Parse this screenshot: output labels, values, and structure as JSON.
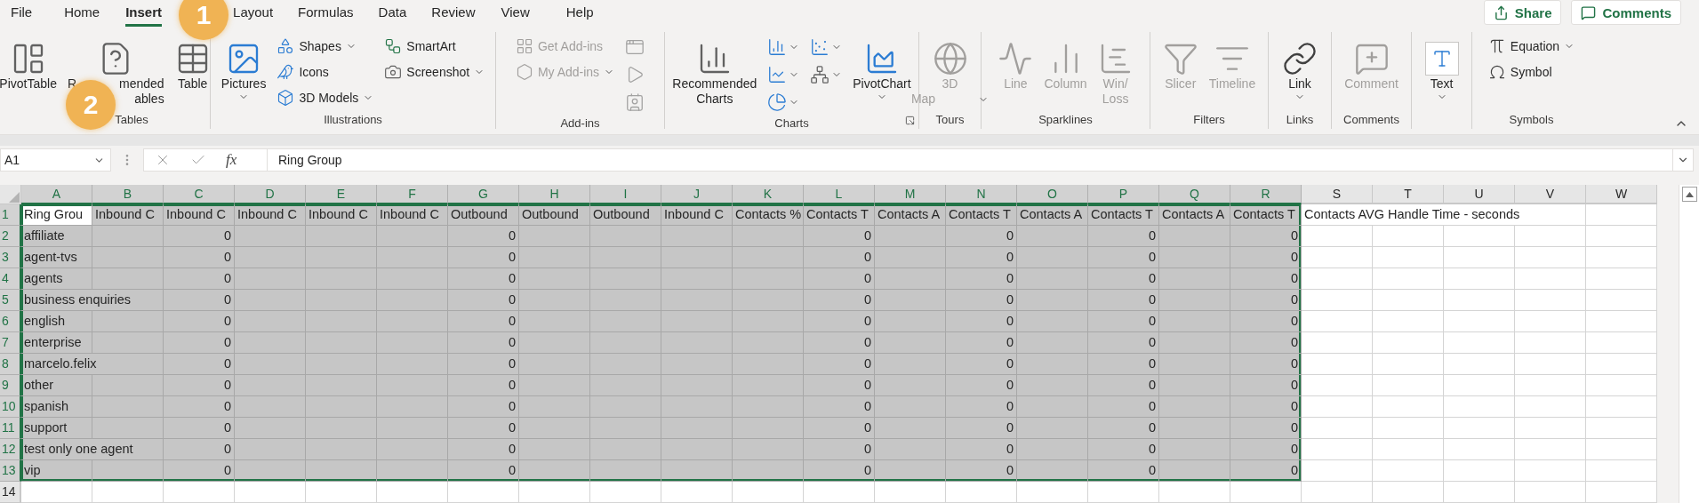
{
  "menu_tabs": [
    {
      "label": "File",
      "selected": false
    },
    {
      "label": "Home",
      "selected": false
    },
    {
      "label": "Insert",
      "selected": true
    },
    {
      "label": "Layout",
      "selected": false
    },
    {
      "label": "Formulas",
      "selected": false
    },
    {
      "label": "Data",
      "selected": false
    },
    {
      "label": "Review",
      "selected": false
    },
    {
      "label": "View",
      "selected": false
    },
    {
      "label": "Help",
      "selected": false
    }
  ],
  "header_buttons": [
    {
      "label": "Share"
    },
    {
      "label": "Comments"
    }
  ],
  "ribbon_groups": [
    {
      "label": "Tables",
      "items": [
        {
          "kind": "large",
          "lines": [
            [
              "PivotTable"
            ]
          ],
          "dropdown": false,
          "disabled": false
        },
        {
          "kind": "large",
          "lines": [
            [
              "R",
              "mended"
            ],
            [
              "ables"
            ]
          ],
          "dropdown": false,
          "disabled": false
        },
        {
          "kind": "large",
          "lines": [
            [
              "Table"
            ]
          ],
          "dropdown": false,
          "disabled": false
        }
      ]
    },
    {
      "label": "Illustrations",
      "items": [
        {
          "kind": "large",
          "lines": [
            [
              "Pictures"
            ]
          ],
          "dropdown": true,
          "disabled": false
        },
        {
          "kind": "stack",
          "items": [
            {
              "kind": "small",
              "label": "Shapes",
              "dropdown": true,
              "disabled": false
            },
            {
              "kind": "small",
              "label": "Icons",
              "dropdown": false,
              "disabled": false
            },
            {
              "kind": "small",
              "label": "3D Models",
              "dropdown": true,
              "disabled": false
            }
          ]
        },
        {
          "kind": "stack",
          "items": [
            {
              "kind": "small",
              "label": "SmartArt",
              "dropdown": false,
              "disabled": false
            },
            {
              "kind": "small",
              "label": "Screenshot",
              "dropdown": true,
              "disabled": false
            }
          ]
        }
      ]
    },
    {
      "label": "Add-ins",
      "items": [
        {
          "kind": "stack",
          "items": [
            {
              "kind": "small",
              "label": "Get Add-ins",
              "dropdown": false,
              "disabled": true
            },
            {
              "kind": "small",
              "label": "My Add-ins",
              "dropdown": true,
              "disabled": true
            }
          ]
        },
        {
          "kind": "stack",
          "items": [
            {
              "kind": "icon",
              "dropdown": false,
              "disabled": true
            },
            {
              "kind": "icon",
              "dropdown": false,
              "disabled": true
            },
            {
              "kind": "icon",
              "dropdown": false,
              "disabled": true
            }
          ]
        }
      ]
    },
    {
      "label": "Charts",
      "launcher": true,
      "items": [
        {
          "kind": "large",
          "lines": [
            [
              "Recommended"
            ],
            [
              "Charts"
            ]
          ],
          "dropdown": false,
          "disabled": false
        },
        {
          "kind": "stack",
          "items": [
            {
              "kind": "icon",
              "dropdown": true,
              "disabled": false
            },
            {
              "kind": "icon",
              "dropdown": true,
              "disabled": false
            },
            {
              "kind": "icon",
              "dropdown": true,
              "disabled": false
            }
          ]
        },
        {
          "kind": "stack",
          "items": [
            {
              "kind": "icon",
              "dropdown": true,
              "disabled": false
            },
            {
              "kind": "icon",
              "dropdown": true,
              "disabled": false
            }
          ]
        },
        {
          "kind": "large",
          "lines": [
            [
              "PivotChart"
            ]
          ],
          "dropdown": true,
          "disabled": false
        }
      ]
    },
    {
      "label": "Tours",
      "items": [
        {
          "kind": "large",
          "lines": [
            [
              "3D"
            ],
            [
              "Map"
            ]
          ],
          "dropdown": true,
          "disabled": true
        }
      ]
    },
    {
      "label": "Sparklines",
      "items": [
        {
          "kind": "large",
          "lines": [
            [
              "Line"
            ]
          ],
          "dropdown": false,
          "disabled": true
        },
        {
          "kind": "large",
          "lines": [
            [
              "Column"
            ]
          ],
          "dropdown": false,
          "disabled": true
        },
        {
          "kind": "large",
          "lines": [
            [
              "Win/"
            ],
            [
              "Loss"
            ]
          ],
          "dropdown": false,
          "disabled": true
        }
      ]
    },
    {
      "label": "Filters",
      "items": [
        {
          "kind": "large",
          "lines": [
            [
              "Slicer"
            ]
          ],
          "dropdown": false,
          "disabled": true
        },
        {
          "kind": "large",
          "lines": [
            [
              "Timeline"
            ]
          ],
          "dropdown": false,
          "disabled": true
        }
      ]
    },
    {
      "label": "Links",
      "items": [
        {
          "kind": "large",
          "lines": [
            [
              "Link"
            ]
          ],
          "dropdown": true,
          "disabled": false
        }
      ]
    },
    {
      "label": "Comments",
      "items": [
        {
          "kind": "large",
          "lines": [
            [
              "Comment"
            ]
          ],
          "dropdown": false,
          "disabled": true
        }
      ]
    },
    {
      "items": [
        {
          "kind": "large",
          "lines": [
            [
              "Text"
            ]
          ],
          "dropdown": true,
          "disabled": false
        }
      ]
    },
    {
      "label": "Symbols",
      "items": [
        {
          "kind": "stack",
          "items": [
            {
              "kind": "small",
              "label": "Equation",
              "dropdown": true,
              "disabled": false
            },
            {
              "kind": "small",
              "label": "Symbol",
              "dropdown": false,
              "disabled": false
            }
          ]
        }
      ]
    }
  ],
  "annotations": [
    {
      "label": "1"
    },
    {
      "label": "2"
    }
  ],
  "formula_bar": {
    "name_box": "A1",
    "function_label": "fx",
    "value": "Ring Group"
  },
  "sheet": {
    "columns": [
      {
        "header": "A",
        "selected": true
      },
      {
        "header": "B",
        "selected": true
      },
      {
        "header": "C",
        "selected": true
      },
      {
        "header": "D",
        "selected": true
      },
      {
        "header": "E",
        "selected": true
      },
      {
        "header": "F",
        "selected": true
      },
      {
        "header": "G",
        "selected": true
      },
      {
        "header": "H",
        "selected": true
      },
      {
        "header": "I",
        "selected": true
      },
      {
        "header": "J",
        "selected": true
      },
      {
        "header": "K",
        "selected": true
      },
      {
        "header": "L",
        "selected": true
      },
      {
        "header": "M",
        "selected": true
      },
      {
        "header": "N",
        "selected": true
      },
      {
        "header": "O",
        "selected": true
      },
      {
        "header": "P",
        "selected": true
      },
      {
        "header": "Q",
        "selected": true
      },
      {
        "header": "R",
        "selected": true
      },
      {
        "header": "S",
        "selected": false
      },
      {
        "header": "T",
        "selected": false
      },
      {
        "header": "U",
        "selected": false
      },
      {
        "header": "V",
        "selected": false
      },
      {
        "header": "W",
        "selected": false
      }
    ],
    "rows": [
      {
        "header": "1",
        "selected": true,
        "cells": [
          {
            "kind": "text",
            "text": "Ring Grou"
          },
          {
            "kind": "text",
            "text": "Inbound C"
          },
          {
            "kind": "text",
            "text": "Inbound C"
          },
          {
            "kind": "text",
            "text": "Inbound C"
          },
          {
            "kind": "text",
            "text": "Inbound C"
          },
          {
            "kind": "text",
            "text": "Inbound C"
          },
          {
            "kind": "text",
            "text": "Outbound"
          },
          {
            "kind": "text",
            "text": "Outbound"
          },
          {
            "kind": "text",
            "text": "Outbound"
          },
          {
            "kind": "text",
            "text": "Inbound C"
          },
          {
            "kind": "text",
            "text": "Contacts %"
          },
          {
            "kind": "text",
            "text": "Contacts T"
          },
          {
            "kind": "text",
            "text": "Contacts A"
          },
          {
            "kind": "text",
            "text": "Contacts T"
          },
          {
            "kind": "text",
            "text": "Contacts A"
          },
          {
            "kind": "text",
            "text": "Contacts T"
          },
          {
            "kind": "text",
            "text": "Contacts A"
          },
          {
            "kind": "text",
            "text": "Contacts T"
          },
          {
            "kind": "text",
            "text": "Contacts AVG Handle Time - seconds"
          },
          null,
          null,
          null,
          null
        ]
      },
      {
        "header": "2",
        "selected": true,
        "cells": [
          {
            "kind": "text",
            "text": "affiliate"
          },
          null,
          {
            "kind": "number",
            "text": "0"
          },
          null,
          null,
          null,
          {
            "kind": "number",
            "text": "0"
          },
          null,
          null,
          null,
          null,
          {
            "kind": "number",
            "text": "0"
          },
          null,
          {
            "kind": "number",
            "text": "0"
          },
          null,
          {
            "kind": "number",
            "text": "0"
          },
          null,
          {
            "kind": "number",
            "text": "0"
          },
          null,
          null,
          null,
          null,
          null
        ]
      },
      {
        "header": "3",
        "selected": true,
        "cells": [
          {
            "kind": "text",
            "text": "agent-tvs"
          },
          null,
          {
            "kind": "number",
            "text": "0"
          },
          null,
          null,
          null,
          {
            "kind": "number",
            "text": "0"
          },
          null,
          null,
          null,
          null,
          {
            "kind": "number",
            "text": "0"
          },
          null,
          {
            "kind": "number",
            "text": "0"
          },
          null,
          {
            "kind": "number",
            "text": "0"
          },
          null,
          {
            "kind": "number",
            "text": "0"
          },
          null,
          null,
          null,
          null,
          null
        ]
      },
      {
        "header": "4",
        "selected": true,
        "cells": [
          {
            "kind": "text",
            "text": "agents"
          },
          null,
          {
            "kind": "number",
            "text": "0"
          },
          null,
          null,
          null,
          {
            "kind": "number",
            "text": "0"
          },
          null,
          null,
          null,
          null,
          {
            "kind": "number",
            "text": "0"
          },
          null,
          {
            "kind": "number",
            "text": "0"
          },
          null,
          {
            "kind": "number",
            "text": "0"
          },
          null,
          {
            "kind": "number",
            "text": "0"
          },
          null,
          null,
          null,
          null,
          null
        ]
      },
      {
        "header": "5",
        "selected": true,
        "cells": [
          {
            "kind": "text",
            "text": "business enquiries"
          },
          null,
          {
            "kind": "number",
            "text": "0"
          },
          null,
          null,
          null,
          {
            "kind": "number",
            "text": "0"
          },
          null,
          null,
          null,
          null,
          {
            "kind": "number",
            "text": "0"
          },
          null,
          {
            "kind": "number",
            "text": "0"
          },
          null,
          {
            "kind": "number",
            "text": "0"
          },
          null,
          {
            "kind": "number",
            "text": "0"
          },
          null,
          null,
          null,
          null,
          null
        ]
      },
      {
        "header": "6",
        "selected": true,
        "cells": [
          {
            "kind": "text",
            "text": "english"
          },
          null,
          {
            "kind": "number",
            "text": "0"
          },
          null,
          null,
          null,
          {
            "kind": "number",
            "text": "0"
          },
          null,
          null,
          null,
          null,
          {
            "kind": "number",
            "text": "0"
          },
          null,
          {
            "kind": "number",
            "text": "0"
          },
          null,
          {
            "kind": "number",
            "text": "0"
          },
          null,
          {
            "kind": "number",
            "text": "0"
          },
          null,
          null,
          null,
          null,
          null
        ]
      },
      {
        "header": "7",
        "selected": true,
        "cells": [
          {
            "kind": "text",
            "text": "enterprise"
          },
          null,
          {
            "kind": "number",
            "text": "0"
          },
          null,
          null,
          null,
          {
            "kind": "number",
            "text": "0"
          },
          null,
          null,
          null,
          null,
          {
            "kind": "number",
            "text": "0"
          },
          null,
          {
            "kind": "number",
            "text": "0"
          },
          null,
          {
            "kind": "number",
            "text": "0"
          },
          null,
          {
            "kind": "number",
            "text": "0"
          },
          null,
          null,
          null,
          null,
          null
        ]
      },
      {
        "header": "8",
        "selected": true,
        "cells": [
          {
            "kind": "text",
            "text": "marcelo.felix"
          },
          null,
          {
            "kind": "number",
            "text": "0"
          },
          null,
          null,
          null,
          {
            "kind": "number",
            "text": "0"
          },
          null,
          null,
          null,
          null,
          {
            "kind": "number",
            "text": "0"
          },
          null,
          {
            "kind": "number",
            "text": "0"
          },
          null,
          {
            "kind": "number",
            "text": "0"
          },
          null,
          {
            "kind": "number",
            "text": "0"
          },
          null,
          null,
          null,
          null,
          null
        ]
      },
      {
        "header": "9",
        "selected": true,
        "cells": [
          {
            "kind": "text",
            "text": "other"
          },
          null,
          {
            "kind": "number",
            "text": "0"
          },
          null,
          null,
          null,
          {
            "kind": "number",
            "text": "0"
          },
          null,
          null,
          null,
          null,
          {
            "kind": "number",
            "text": "0"
          },
          null,
          {
            "kind": "number",
            "text": "0"
          },
          null,
          {
            "kind": "number",
            "text": "0"
          },
          null,
          {
            "kind": "number",
            "text": "0"
          },
          null,
          null,
          null,
          null,
          null
        ]
      },
      {
        "header": "10",
        "selected": true,
        "cells": [
          {
            "kind": "text",
            "text": "spanish"
          },
          null,
          {
            "kind": "number",
            "text": "0"
          },
          null,
          null,
          null,
          {
            "kind": "number",
            "text": "0"
          },
          null,
          null,
          null,
          null,
          {
            "kind": "number",
            "text": "0"
          },
          null,
          {
            "kind": "number",
            "text": "0"
          },
          null,
          {
            "kind": "number",
            "text": "0"
          },
          null,
          {
            "kind": "number",
            "text": "0"
          },
          null,
          null,
          null,
          null,
          null
        ]
      },
      {
        "header": "11",
        "selected": true,
        "cells": [
          {
            "kind": "text",
            "text": "support"
          },
          null,
          {
            "kind": "number",
            "text": "0"
          },
          null,
          null,
          null,
          {
            "kind": "number",
            "text": "0"
          },
          null,
          null,
          null,
          null,
          {
            "kind": "number",
            "text": "0"
          },
          null,
          {
            "kind": "number",
            "text": "0"
          },
          null,
          {
            "kind": "number",
            "text": "0"
          },
          null,
          {
            "kind": "number",
            "text": "0"
          },
          null,
          null,
          null,
          null,
          null
        ]
      },
      {
        "header": "12",
        "selected": true,
        "cells": [
          {
            "kind": "text",
            "text": "test only one agent"
          },
          null,
          {
            "kind": "number",
            "text": "0"
          },
          null,
          null,
          null,
          {
            "kind": "number",
            "text": "0"
          },
          null,
          null,
          null,
          null,
          {
            "kind": "number",
            "text": "0"
          },
          null,
          {
            "kind": "number",
            "text": "0"
          },
          null,
          {
            "kind": "number",
            "text": "0"
          },
          null,
          {
            "kind": "number",
            "text": "0"
          },
          null,
          null,
          null,
          null,
          null
        ]
      },
      {
        "header": "13",
        "selected": true,
        "cells": [
          {
            "kind": "text",
            "text": "vip"
          },
          null,
          {
            "kind": "number",
            "text": "0"
          },
          null,
          null,
          null,
          {
            "kind": "number",
            "text": "0"
          },
          null,
          null,
          null,
          null,
          {
            "kind": "number",
            "text": "0"
          },
          null,
          {
            "kind": "number",
            "text": "0"
          },
          null,
          {
            "kind": "number",
            "text": "0"
          },
          null,
          {
            "kind": "number",
            "text": "0"
          },
          null,
          null,
          null,
          null,
          null
        ]
      },
      {
        "header": "14",
        "selected": false,
        "cells": [
          null,
          null,
          null,
          null,
          null,
          null,
          null,
          null,
          null,
          null,
          null,
          null,
          null,
          null,
          null,
          null,
          null,
          null,
          null,
          null,
          null,
          null,
          null
        ]
      }
    ]
  }
}
